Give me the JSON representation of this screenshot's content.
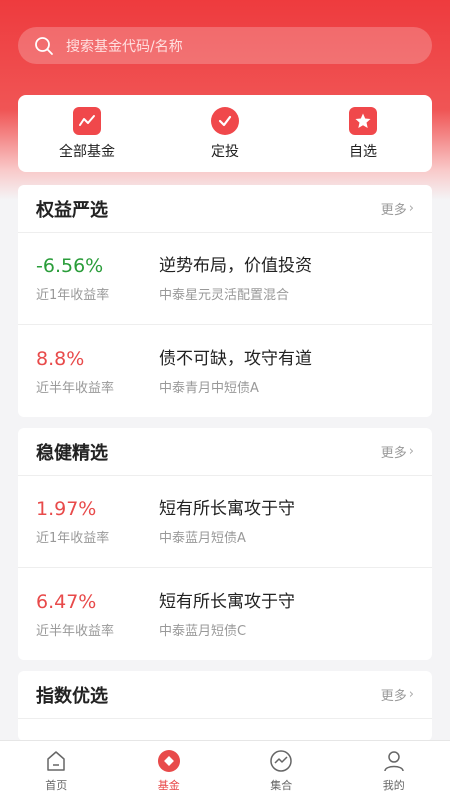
{
  "search": {
    "placeholder": "搜索基金代码/名称"
  },
  "quick": [
    {
      "label": "全部基金",
      "icon": "chart-icon"
    },
    {
      "label": "定投",
      "icon": "alarm-clock-icon"
    },
    {
      "label": "自选",
      "icon": "star-icon"
    }
  ],
  "sections": [
    {
      "title": "权益严选",
      "more": "更多",
      "items": [
        {
          "rate": "-6.56%",
          "rate_label": "近1年收益率",
          "slogan": "逆势布局，价值投资",
          "fund": "中泰星元灵活配置混合"
        },
        {
          "rate": "8.8%",
          "rate_label": "近半年收益率",
          "slogan": "债不可缺，攻守有道",
          "fund": "中泰青月中短债A"
        }
      ]
    },
    {
      "title": "稳健精选",
      "more": "更多",
      "items": [
        {
          "rate": "1.97%",
          "rate_label": "近1年收益率",
          "slogan": "短有所长寓攻于守",
          "fund": "中泰蓝月短债A"
        },
        {
          "rate": "6.47%",
          "rate_label": "近半年收益率",
          "slogan": "短有所长寓攻于守",
          "fund": "中泰蓝月短债C"
        }
      ]
    },
    {
      "title": "指数优选",
      "more": "更多",
      "items": []
    }
  ],
  "tabs": [
    {
      "label": "首页",
      "icon": "home-icon",
      "active": false
    },
    {
      "label": "基金",
      "icon": "fund-icon",
      "active": true
    },
    {
      "label": "集合",
      "icon": "collection-icon",
      "active": false
    },
    {
      "label": "我的",
      "icon": "user-icon",
      "active": false
    }
  ],
  "colors": {
    "brand": "#e84a4a",
    "negative": "#2a9d3a"
  }
}
